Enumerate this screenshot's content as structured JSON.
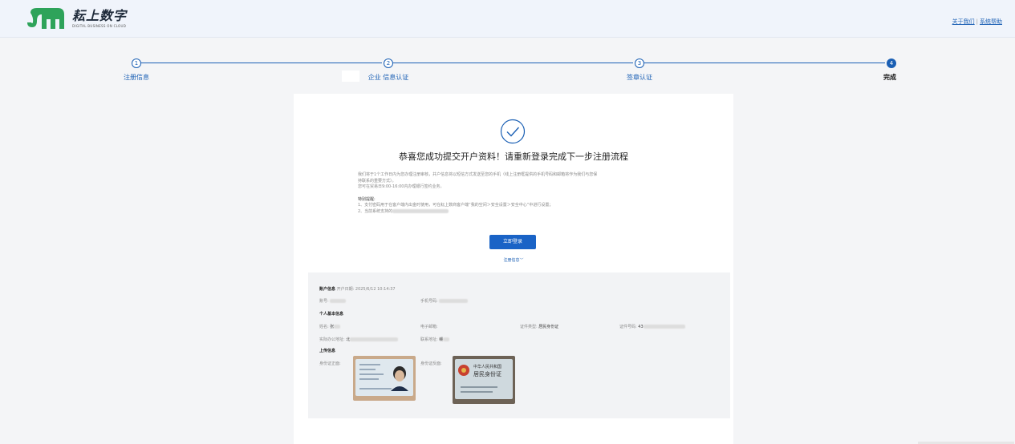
{
  "header": {
    "logo_title": "耘上数字",
    "logo_subtitle": "DIGITAL BUSINESS ON CLOUD",
    "links": [
      "关于我们",
      "系统帮助"
    ],
    "link_separator": "|"
  },
  "steps": [
    {
      "number": "1",
      "label": "注册信息",
      "state": "done"
    },
    {
      "number": "2",
      "label": "企业 信息认证",
      "state": "done"
    },
    {
      "number": "3",
      "label": "签章认证",
      "state": "done"
    },
    {
      "number": "4",
      "label": "完成",
      "state": "current"
    }
  ],
  "result": {
    "title": "恭喜您成功提交开户资料！请重新登录完成下一步注册流程",
    "notice_1": "我们将于1个工作日内为您办理注册审核，并户信息将以短信方式发送至您的手机（线上注册框提供的手机号码和邮箱将作为我们与您保",
    "notice_2": "持联系的重要方式）。",
    "notice_3": "您可在贸易日9:00-16:00内办理银行签约业务。",
    "tip_title": "特别提醒:",
    "tip_1": "1、支付密码用于在客户端内出金时使用，可在耘上数商客户端“我的空间＞安全设置＞安全中心”中进行设置；",
    "tip_2": "2、当前系统支持的",
    "login_button": "立即登录",
    "toggle_label": "注册信息",
    "toggle_icon": "chevron-down-icon"
  },
  "account": {
    "section_title": "账户信息",
    "open_date_label": "开户日期:",
    "open_date": "2025/6/12 10:14:37",
    "account_label": "账号:",
    "phone_label": "手机号码:"
  },
  "personal": {
    "section_title": "个人基本信息",
    "name_label": "姓名:",
    "name_value": "张",
    "email_label": "电子邮箱:",
    "id_type_label": "证件类型:",
    "id_type_value": "居民身份证",
    "id_number_label": "证件号码:",
    "id_number_value": "43",
    "address_label": "实际办公地址:",
    "address_value": "北",
    "contact_label": "联系地址:",
    "contact_value": "赣"
  },
  "uploads": {
    "section_title": "上传信息",
    "id_front_label": "身份证正面:",
    "id_back_label": "身份证反面:",
    "id_back_header": "中华人民共和国",
    "id_back_title": "居民身份证"
  },
  "colors": {
    "primary": "#1a5fb4",
    "button": "#1a63c6",
    "panel": "#f2f3f5"
  }
}
